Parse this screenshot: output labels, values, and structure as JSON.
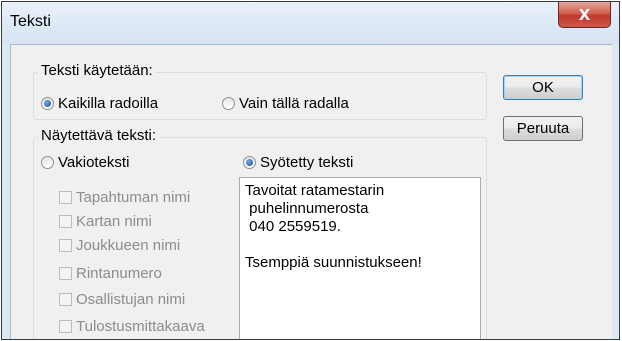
{
  "window": {
    "title": "Teksti",
    "close_glyph": "X",
    "accent": "#c0392b"
  },
  "group_scope": {
    "legend": "Teksti käytetään:",
    "options": [
      {
        "label": "Kaikilla radoilla",
        "selected": true
      },
      {
        "label": "Vain tällä radalla",
        "selected": false
      }
    ]
  },
  "group_text": {
    "legend": "Näytettävä teksti:",
    "standard_label": "Vakioteksti",
    "standard_selected": false,
    "custom_label": "Syötetty teksti",
    "custom_selected": true,
    "checkboxes": [
      "Tapahtuman nimi",
      "Kartan nimi",
      "Joukkueen nimi",
      "Rintanumero",
      "Osallistujan nimi",
      "Tulostusmittakaava"
    ],
    "custom_text": "Tavoitat ratamestarin\n puhelinnumerosta\n 040 2559519.\n\nTsemppiä suunnistukseen!"
  },
  "buttons": {
    "ok": "OK",
    "cancel": "Peruuta"
  }
}
